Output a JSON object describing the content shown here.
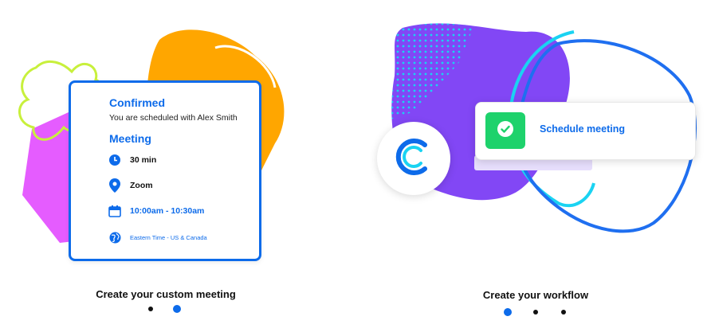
{
  "colors": {
    "accent_blue": "#0d6bea",
    "orange": "#ffa600",
    "magenta": "#e55cff",
    "lime": "#c8f03c",
    "purple": "#8247f5",
    "cyan": "#1ad3f2",
    "green": "#1ed26c"
  },
  "left_panel": {
    "card": {
      "confirmed_title": "Confirmed",
      "scheduled_text": "You are scheduled with Alex Smith",
      "meeting_title": "Meeting",
      "duration": {
        "icon": "clock-icon",
        "text": "30 min"
      },
      "location": {
        "icon": "map-pin-icon",
        "text": "Zoom"
      },
      "time": {
        "icon": "calendar-icon",
        "text": "10:00am - 10:30am"
      },
      "timezone": {
        "icon": "globe-icon",
        "text": "Eastern Time - US & Canada"
      }
    },
    "caption": "Create your custom meeting",
    "pagination": {
      "count": 2,
      "active_index": 1
    }
  },
  "right_panel": {
    "logo": "calendly-logo-icon",
    "action_card": {
      "icon": "checkmark-icon",
      "label": "Schedule meeting"
    },
    "caption": "Create your workflow",
    "pagination": {
      "count": 3,
      "active_index": 0
    }
  }
}
